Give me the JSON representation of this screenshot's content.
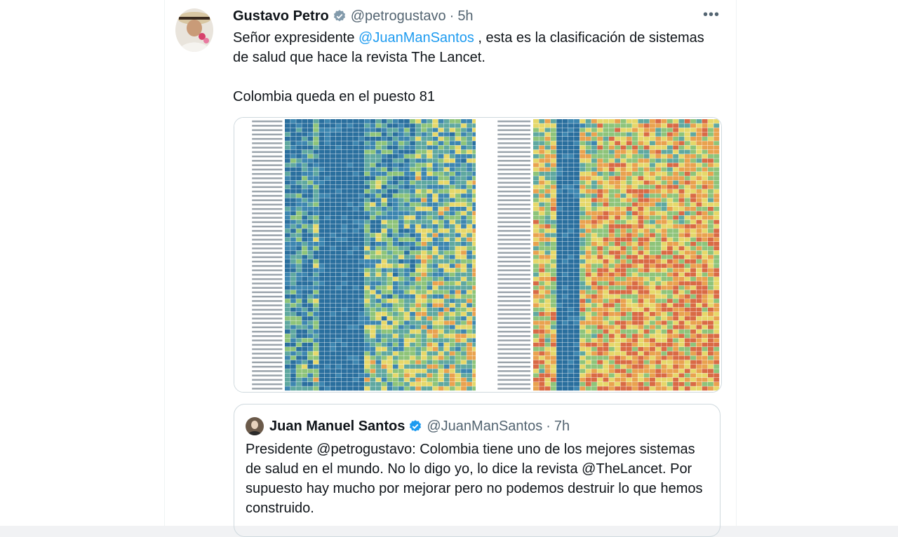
{
  "tweet": {
    "author_name": "Gustavo Petro",
    "author_handle": "@petrogustavo",
    "separator": "·",
    "time": "5h",
    "more_label": "•••",
    "text_line1_a": "Señor expresidente ",
    "mention": "@JuanManSantos",
    "text_line1_b": " , esta es la clasificación de sistemas de salud que hace la revista The Lancet.",
    "text_line2": "Colombia queda en el puesto 81"
  },
  "quote": {
    "author_name": "Juan Manuel Santos",
    "author_handle": "@JuanManSantos",
    "separator": "·",
    "time": "7h",
    "text": "Presidente @petrogustavo: Colombia tiene uno de los mejores sistemas de salud en el mundo. No lo digo yo, lo dice la revista @TheLancet. Por supuesto hay mucho por mejorar pero no podemos destruir lo que hemos construido."
  },
  "media": {
    "alt": "Heatmap classification of health systems by The Lancet",
    "colors": {
      "dark_blue": "#2a6f9e",
      "blue": "#3d86b0",
      "teal": "#5fa8a0",
      "green": "#8ec47a",
      "yellow": "#e6d86a",
      "orange": "#e9a24f",
      "red": "#d96a45"
    }
  },
  "colors": {
    "accent": "#1d9bf0",
    "muted": "#536471",
    "text": "#0f1419"
  }
}
